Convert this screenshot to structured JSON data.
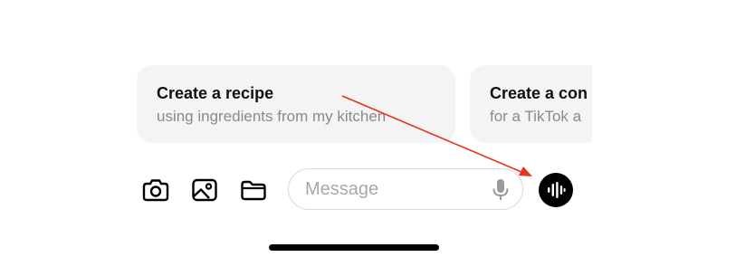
{
  "suggestions": [
    {
      "title": "Create a recipe",
      "subtitle": "using ingredients from my kitchen"
    },
    {
      "title": "Create a con",
      "subtitle": "for a TikTok a"
    }
  ],
  "toolbar": {
    "camera_icon": "camera-icon",
    "photo_icon": "image-icon",
    "folder_icon": "folder-icon"
  },
  "message": {
    "placeholder": "Message",
    "value": "",
    "mic_icon": "microphone-icon"
  },
  "voice_button": {
    "icon": "voice-waveform-icon",
    "color": "#000000"
  },
  "annotation": {
    "arrow_color": "#e8321f"
  }
}
